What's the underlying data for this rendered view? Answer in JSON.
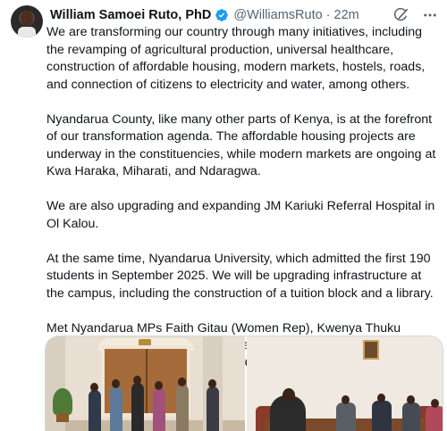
{
  "author": {
    "name": "William Samoei Ruto, PhD",
    "handle": "@WilliamsRuto",
    "separator": "·",
    "time": "22m"
  },
  "icons": {
    "verified": "verified-badge-icon",
    "grok": "grok-slash-icon",
    "more": "more-options-icon"
  },
  "colors": {
    "verified": "#1d9bf0",
    "secondary_text": "#536471",
    "text": "#0f1419"
  },
  "post": {
    "paragraphs": [
      "We are transforming our country through many initiatives, including the revamping of agricultural production,  universal healthcare, construction of affordable housing, modern markets, hostels, roads, and connection of citizens to electricity and water, among others.",
      "Nyandarua County, like  many other parts of Kenya, is at the forefront of our transformation agenda. The affordable housing projects are underway in the constituencies, while modern markets are ongoing at Kwa Haraka, Miharati, and Ndaragwa.",
      "We are also upgrading and expanding JM Kariuki Referral Hospital in Ol Kalou.",
      "At the same time, Nyandarua University, which admitted the first 190 students in September 2025. We will be upgrading infrastructure at the campus, including the construction of a tuition block and a library.",
      "Met Nyandarua MPs Faith Gitau (Women Rep), Kwenya Thuku (Kinangop), Njuguna Kiaraho (Ol Kalou), George Gachagua (Ndaragwa), and Michael Muchira (Oljororok), State House Nairobi."
    ]
  }
}
